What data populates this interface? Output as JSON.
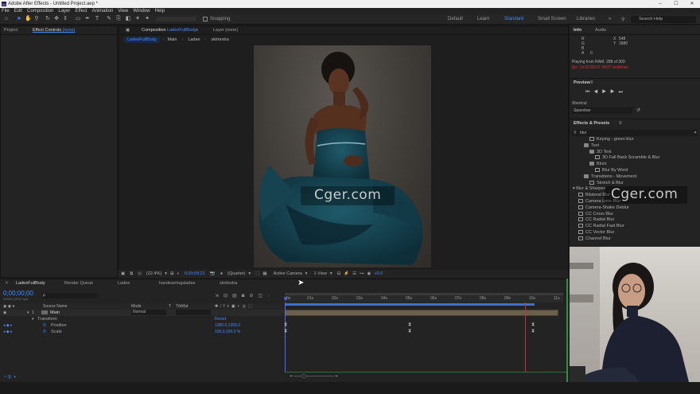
{
  "window": {
    "title": "Adobe After Effects - Untitled Project.aep *",
    "app_icon": "Ae",
    "controls": [
      "–",
      "☐",
      "✕"
    ]
  },
  "menu": [
    "File",
    "Edit",
    "Composition",
    "Layer",
    "Effect",
    "Animation",
    "View",
    "Window",
    "Help"
  ],
  "toolbar": {
    "snapping_label": "Snapping",
    "workspaces": [
      "Default",
      "Learn",
      "Standard",
      "Small Screen",
      "Libraries"
    ],
    "active_workspace": "Standard",
    "search_placeholder": "Search Help"
  },
  "project_panel": {
    "tab_project": "Project",
    "tab_effect_controls": "Effect Controls",
    "effect_controls_target": "(none)"
  },
  "comp_panel": {
    "tab_composition": "Composition",
    "composition_name": "LadeeFullBody",
    "tab_layer": "Layer",
    "layer_value": "(none)",
    "breadcrumbs": [
      "LadeeFullBody",
      "Main",
      "Ladee",
      "skirtextra"
    ]
  },
  "viewer_bar": {
    "zoom": "(22.4%)",
    "timecode": "0;00;09;21",
    "resolution": "(Quarter)",
    "camera": "Active Camera",
    "views": "1 View",
    "exposure": "+0.0"
  },
  "watermarks": [
    "Cger.com",
    "Cger.com"
  ],
  "timeline": {
    "tabs": [
      "LadeeFullBody",
      "Render Queue",
      "Ladee",
      "handearringsladee",
      "skirtextra"
    ],
    "current_time": "0;00;00;00",
    "fps_hint": "00000 (29.97 fps)",
    "search_placeholder": "ρ",
    "columns": {
      "source_name": "Source Name",
      "mode": "Mode",
      "t": "T",
      "trkmat": "TrkMat"
    },
    "ruler_ticks": [
      "0s",
      "01s",
      "02s",
      "03s",
      "04s",
      "05s",
      "06s",
      "07s",
      "08s",
      "09s",
      "10s",
      "11s"
    ],
    "layer": {
      "index": "1",
      "name": "Main",
      "mode": "Normal"
    },
    "transform": {
      "label": "Transform",
      "reset": "Reset"
    },
    "properties": [
      {
        "name": "Position",
        "value": "1080.0,1350.0"
      },
      {
        "name": "Scale",
        "value": "100.0,100.0 %"
      }
    ]
  },
  "info_panel": {
    "tab_info": "Info",
    "tab_audio": "Audio",
    "channels": [
      "R",
      "G",
      "B",
      "A"
    ],
    "alpha_value": "0",
    "x_label": "X",
    "x_value": "548",
    "y_label": "Y",
    "y_value": "1880",
    "playing": "Playing from RAM: 288 of 300",
    "fps_warning": "fps: 14.91/29.97 (NOT realtime)"
  },
  "preview_panel": {
    "title": "Preview",
    "shortcut_label": "Shortcut",
    "shortcut_value": "Spacebar"
  },
  "effects_panel": {
    "title": "Effects & Presets",
    "search_value": "blur",
    "items": [
      {
        "text": "Keying - green blur",
        "indent": 3,
        "icon": "doc"
      },
      {
        "text": "Text",
        "indent": 2,
        "icon": "folder"
      },
      {
        "text": "3D Text",
        "indent": 3,
        "icon": "folder"
      },
      {
        "text": "3D Fall Back Scramble & Blur",
        "indent": 4,
        "icon": "doc"
      },
      {
        "text": "Blurs",
        "indent": 3,
        "icon": "folder"
      },
      {
        "text": "Blur By Word",
        "indent": 4,
        "icon": "doc"
      },
      {
        "text": "Transitions - Movement",
        "indent": 2,
        "icon": "folder"
      },
      {
        "text": "Stretch & Blur",
        "indent": 3,
        "icon": "doc"
      },
      {
        "text": "Blur & Sharpen",
        "indent": 0,
        "icon": "none"
      },
      {
        "text": "Bilateral Blur",
        "indent": 1,
        "icon": "fx"
      },
      {
        "text": "Camera Lens Blur",
        "indent": 1,
        "icon": "fx"
      },
      {
        "text": "Camera-Shake Deblur",
        "indent": 1,
        "icon": "fx"
      },
      {
        "text": "CC Cross Blur",
        "indent": 1,
        "icon": "fx"
      },
      {
        "text": "CC Radial Blur",
        "indent": 1,
        "icon": "fx"
      },
      {
        "text": "CC Radial Fast Blur",
        "indent": 1,
        "icon": "fx"
      },
      {
        "text": "CC Vector Blur",
        "indent": 1,
        "icon": "fx"
      },
      {
        "text": "Channel Blur",
        "indent": 1,
        "icon": "fx"
      }
    ]
  },
  "colors": {
    "accent": "#3f8cff",
    "playhead": "#4a6cff",
    "work_end": "#c0304a",
    "warning": "#e03030"
  }
}
